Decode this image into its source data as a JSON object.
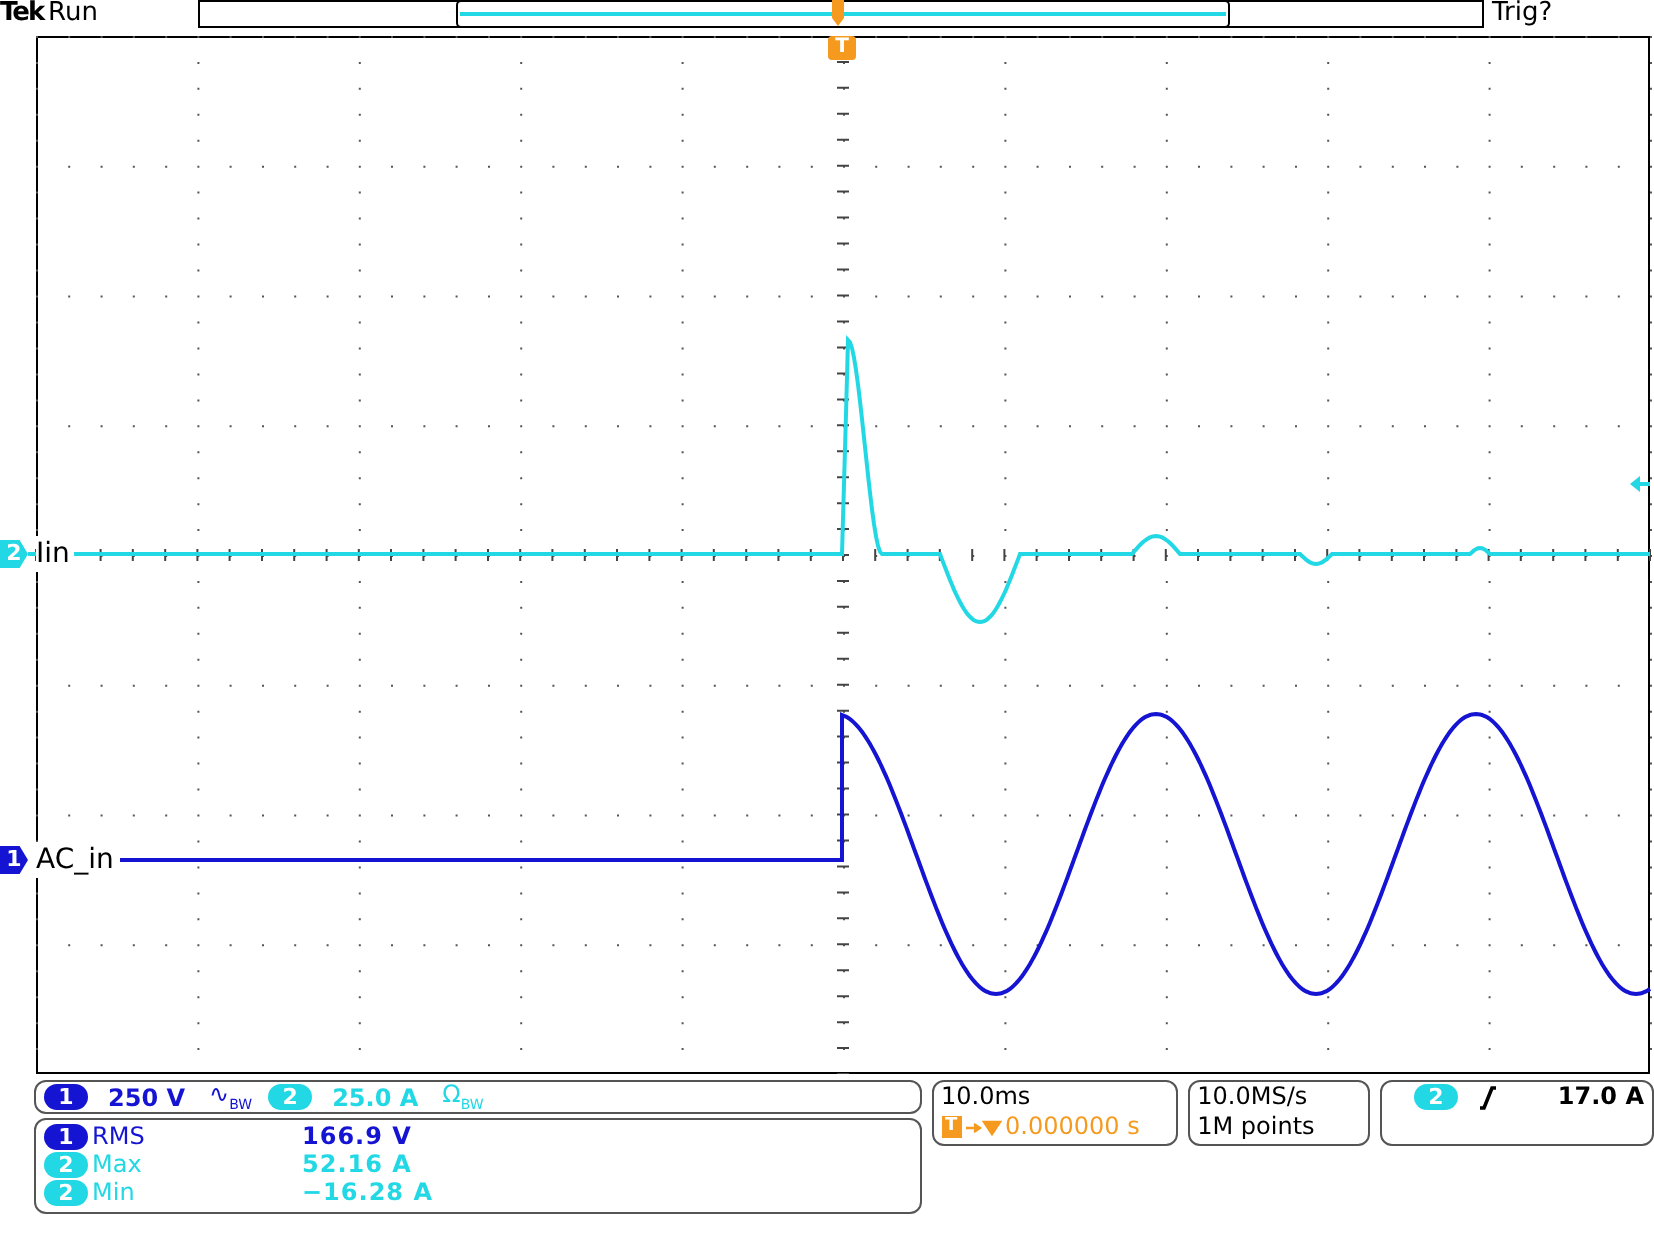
{
  "header": {
    "brand": "Tek",
    "status": "Run",
    "trigger_status": "Trig?",
    "trigger_marker": "T"
  },
  "channels": [
    {
      "number": "2",
      "label": "Iin",
      "color": "#22d8e4"
    },
    {
      "number": "1",
      "label": "AC_in",
      "color": "#1414d2"
    }
  ],
  "vertical": [
    {
      "number": "1",
      "scale": "250 V",
      "symbol": "∿",
      "bw": "BW",
      "color": "#1414d2"
    },
    {
      "number": "2",
      "scale": "25.0 A",
      "symbol": "Ω",
      "bw": "BW",
      "color": "#22d8e4"
    }
  ],
  "measurements": [
    {
      "number": "1",
      "name": "RMS",
      "value": "166.9 V",
      "color": "#1414d2"
    },
    {
      "number": "2",
      "name": "Max",
      "value": "52.16 A",
      "color": "#22d8e4"
    },
    {
      "number": "2",
      "name": "Min",
      "value": "−16.28 A",
      "color": "#22d8e4"
    }
  ],
  "horizontal": {
    "scale": "10.0ms",
    "position_marker": "T",
    "position": "0.000000 s"
  },
  "acquisition": {
    "sample_rate": "10.0MS/s",
    "record_length": "1M points"
  },
  "trigger": {
    "number": "2",
    "level": "17.0 A",
    "color": "#22d8e4"
  }
}
